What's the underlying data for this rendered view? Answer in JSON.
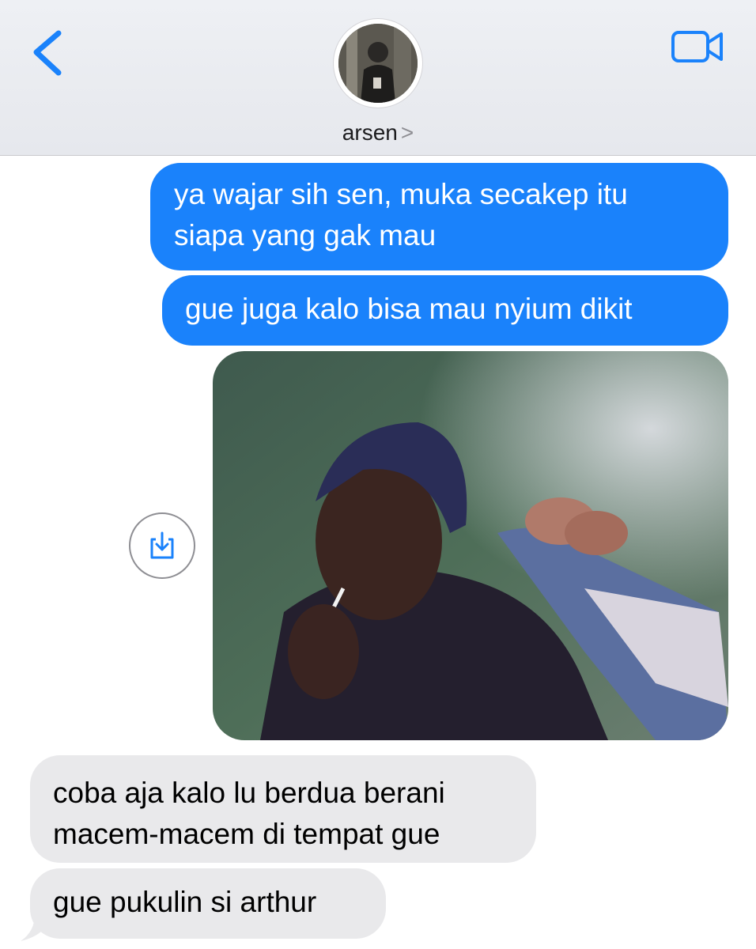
{
  "header": {
    "contact_name": "arsen",
    "chevron": ">",
    "back_icon": "chevron-left-icon",
    "video_icon": "video-camera-icon",
    "accent_color": "#1a82fb"
  },
  "messages": [
    {
      "direction": "outgoing",
      "text_lines": [
        "ya wajar sih sen, muka secakep itu",
        "siapa yang gak mau"
      ]
    },
    {
      "direction": "outgoing",
      "text_lines": [
        "gue juga kalo bisa mau nyium dikit"
      ]
    },
    {
      "direction": "outgoing",
      "type": "image",
      "save_icon": "save-download-icon"
    },
    {
      "direction": "incoming",
      "text_lines": [
        "coba aja kalo lu berdua berani",
        "macem-macem di tempat gue"
      ]
    },
    {
      "direction": "incoming",
      "text_lines": [
        "gue pukulin si arthur"
      ]
    }
  ],
  "colors": {
    "outgoing_bubble": "#1a82fb",
    "incoming_bubble": "#e9e9eb",
    "header_bg": "#eef0f4"
  }
}
